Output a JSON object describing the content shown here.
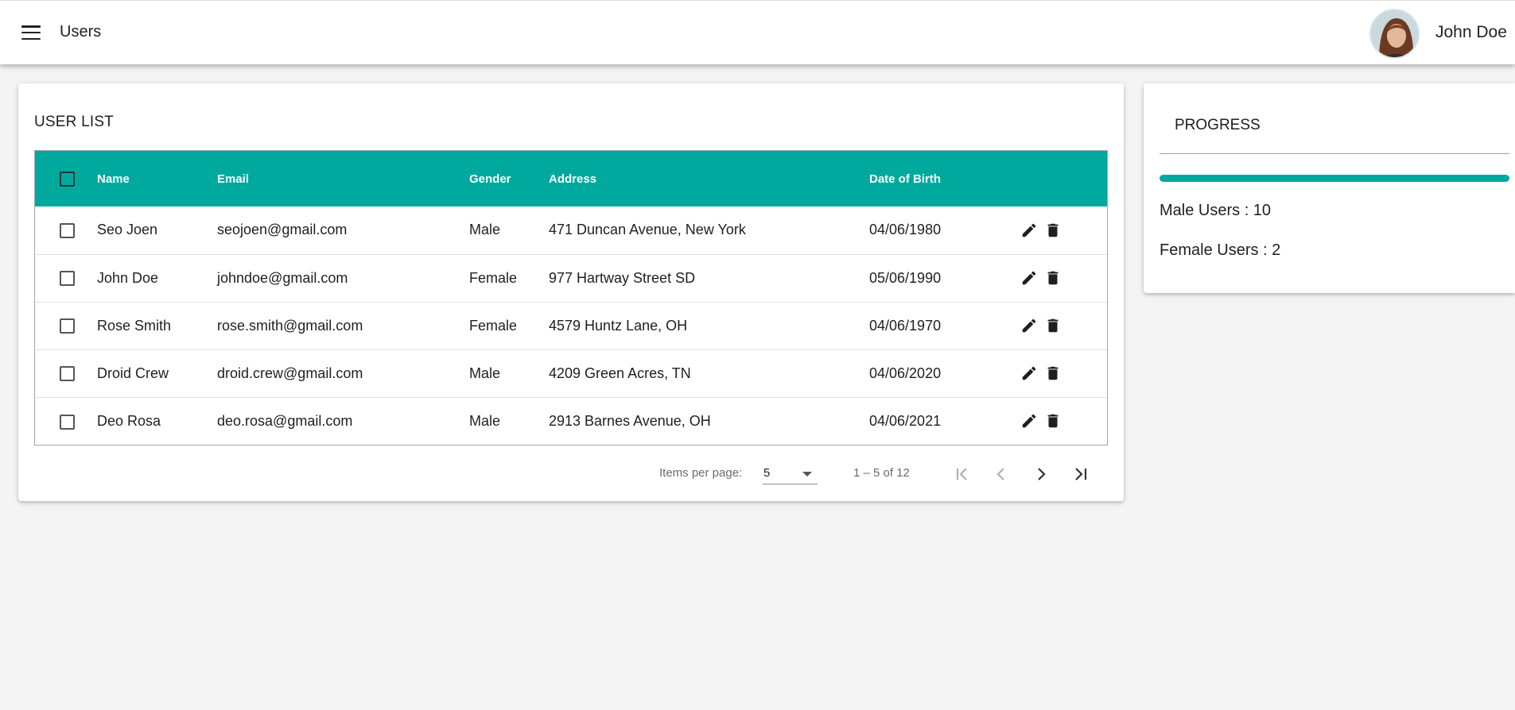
{
  "toolbar": {
    "title": "Users",
    "user_name": "John Doe",
    "menu_icon": "menu-icon",
    "avatar": "avatar-photo"
  },
  "user_list": {
    "title": "USER LIST",
    "header_color": "#00a99d",
    "columns": [
      "Name",
      "Email",
      "Gender",
      "Address",
      "Date of Birth"
    ],
    "rows": [
      {
        "name": "Seo Joen",
        "email": "seojoen@gmail.com",
        "gender": "Male",
        "address": "471 Duncan Avenue, New York",
        "dob": "04/06/1980"
      },
      {
        "name": "John Doe",
        "email": "johndoe@gmail.com",
        "gender": "Female",
        "address": "977 Hartway Street SD",
        "dob": "05/06/1990"
      },
      {
        "name": "Rose Smith",
        "email": "rose.smith@gmail.com",
        "gender": "Female",
        "address": "4579 Huntz Lane, OH",
        "dob": "04/06/1970"
      },
      {
        "name": "Droid Crew",
        "email": "droid.crew@gmail.com",
        "gender": "Male",
        "address": "4209 Green Acres, TN",
        "dob": "04/06/2020"
      },
      {
        "name": "Deo Rosa",
        "email": "deo.rosa@gmail.com",
        "gender": "Male",
        "address": "2913 Barnes Avenue, OH",
        "dob": "04/06/2021"
      }
    ],
    "row_actions": [
      "edit-icon",
      "delete-icon"
    ]
  },
  "paginator": {
    "items_per_page_label": "Items per page:",
    "items_per_page_value": "5",
    "range_label": "1 – 5 of 12",
    "buttons": [
      "first-page-icon",
      "previous-page-icon",
      "next-page-icon",
      "last-page-icon"
    ]
  },
  "progress": {
    "title": "PROGRESS",
    "fraction": 1.0,
    "male_label": "Male Users : 10",
    "female_label": "Female Users : 2",
    "accent": "#00a99d"
  }
}
